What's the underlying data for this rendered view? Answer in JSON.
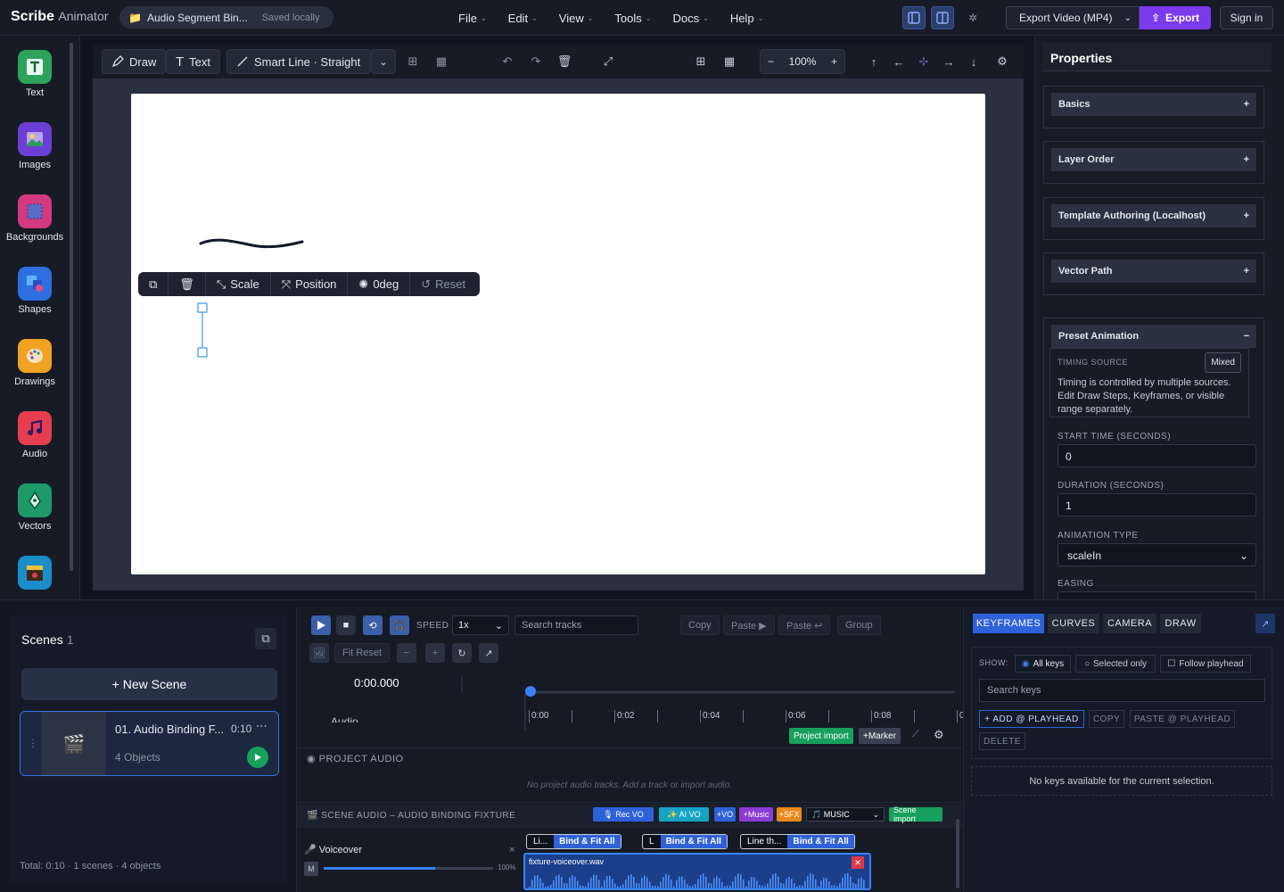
{
  "app": {
    "brand": "Scribe",
    "brand_sub": "Animator"
  },
  "project": {
    "name": "Audio Segment Bin...",
    "status": "Saved locally"
  },
  "menu": [
    "File",
    "Edit",
    "View",
    "Tools",
    "Docs",
    "Help"
  ],
  "header": {
    "export_format": "Export Video (MP4)",
    "export_label": "Export",
    "signin_label": "Sign in"
  },
  "library": [
    {
      "label": "Text",
      "icon": "text-icon",
      "color": "#2ea25a"
    },
    {
      "label": "Images",
      "icon": "image-icon",
      "color": "#6b3fd4"
    },
    {
      "label": "Backgrounds",
      "icon": "background-icon",
      "color": "#d43a80"
    },
    {
      "label": "Shapes",
      "icon": "shapes-icon",
      "color": "#2e6fe0"
    },
    {
      "label": "Drawings",
      "icon": "palette-icon",
      "color": "#f0a323"
    },
    {
      "label": "Audio",
      "icon": "music-note-icon",
      "color": "#e63e4e"
    },
    {
      "label": "Vectors",
      "icon": "pen-nib-icon",
      "color": "#1e9a6a"
    },
    {
      "label": "",
      "icon": "clapper-icon",
      "color": "#1b8dc8"
    }
  ],
  "toolbar": {
    "draw": "Draw",
    "text": "Text",
    "smart_line": "Smart Line · Straight",
    "zoom": "100%"
  },
  "selection_toolbar": {
    "scale": "Scale",
    "position": "Position",
    "rotation": "0deg",
    "reset": "Reset"
  },
  "properties": {
    "title": "Properties",
    "sections": [
      "Basics",
      "Layer Order",
      "Template Authoring (Localhost)",
      "Vector Path"
    ],
    "preset_animation": {
      "title": "Preset Animation",
      "timing_label": "TIMING SOURCE",
      "timing_badge": "Mixed",
      "timing_text": "Timing is controlled by multiple sources. Edit Draw Steps, Keyframes, or visible range separately.",
      "start_label": "START TIME (SECONDS)",
      "start_value": "0",
      "duration_label": "DURATION (SECONDS)",
      "duration_value": "1",
      "type_label": "ANIMATION TYPE",
      "type_value": "scaleIn",
      "easing_label": "EASING"
    }
  },
  "scenes": {
    "title": "Scenes",
    "count": "1",
    "new_scene": "+ New Scene",
    "card": {
      "name": "01.  Audio Binding F...",
      "duration": "0:10",
      "objects": "4 Objects"
    },
    "total": "Total: 0:10 · 1 scenes · 4 objects"
  },
  "timeline": {
    "speed_label": "SPEED",
    "speed_value": "1x",
    "search_placeholder": "Search tracks",
    "copy": "Copy",
    "paste": "Paste ▶",
    "paste2": "Paste ↩",
    "group": "Group",
    "fit_reset": "Fit Reset",
    "time": "0:00.000",
    "ticks": [
      "0:00",
      "0:02",
      "0:04",
      "0:06",
      "0:08",
      "0"
    ],
    "audio_header": "Audio",
    "project_import": "Project import",
    "marker": "+Marker",
    "project_audio": "PROJECT AUDIO",
    "no_project_audio": "No project audio tracks. Add a track or import audio.",
    "scene_audio": "SCENE AUDIO – AUDIO BINDING FIXTURE",
    "pills": {
      "rec_vo": "🎙 Rec VO",
      "ai_vo": "✨ AI VO",
      "vo": "+VO",
      "music": "+Music",
      "sfx": "+SFX",
      "music_sel": "🎵 MUSIC",
      "scene_import": "Scene import"
    },
    "track": {
      "name": "Voiceover",
      "mute": "M",
      "volume": "100%",
      "volume_level": 0.66,
      "clip": "fixture-voiceover.wav"
    },
    "clips": [
      {
        "name": "Li...",
        "bind": "Bind & Fit All"
      },
      {
        "name": "L",
        "bind": "Bind & Fit All"
      },
      {
        "name": "Line th...",
        "bind": "Bind & Fit All"
      }
    ]
  },
  "keyframes": {
    "tabs": [
      "KEYFRAMES",
      "CURVES",
      "CAMERA",
      "DRAW"
    ],
    "show_label": "SHOW:",
    "all_keys": "All keys",
    "selected_only": "Selected only",
    "follow": "Follow playhead",
    "search_placeholder": "Search keys",
    "add": "+ ADD @ PLAYHEAD",
    "copy": "COPY",
    "paste": "PASTE @ PLAYHEAD",
    "delete": "DELETE",
    "empty": "No keys available for the current selection."
  },
  "colors": {
    "accent": "#7c3aed",
    "primary": "#2f61d8",
    "green": "#17a05d"
  }
}
